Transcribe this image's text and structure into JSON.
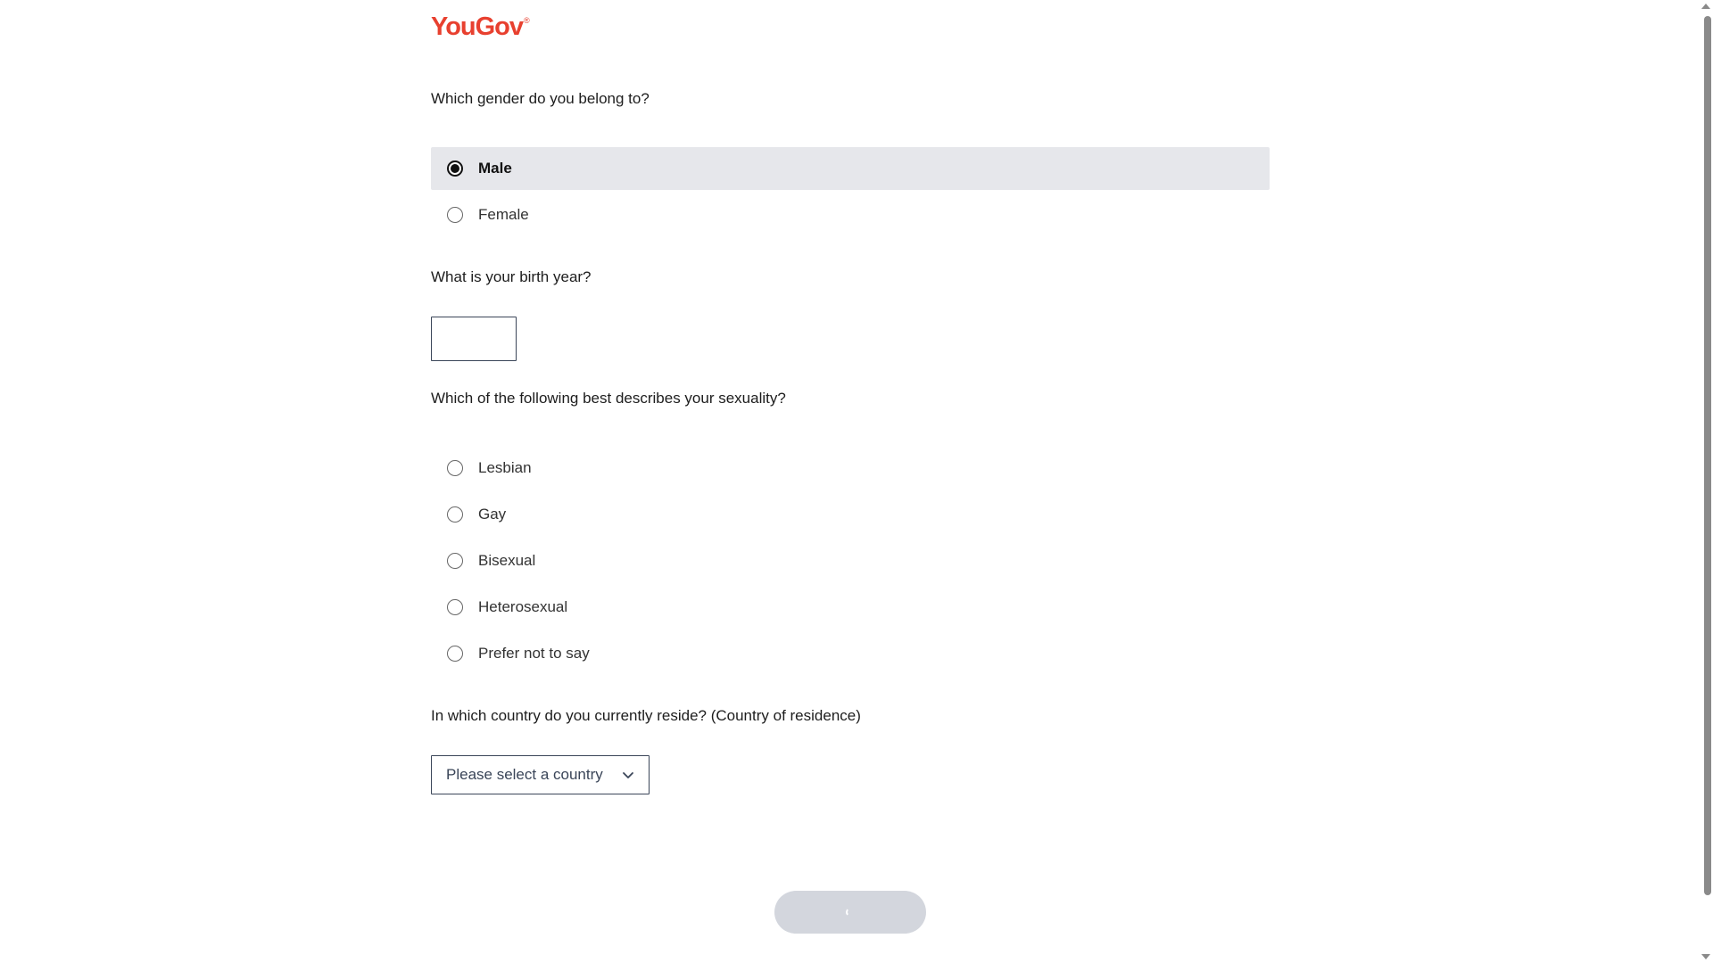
{
  "brand": {
    "logo_text": "YouGov",
    "logo_mark": "®",
    "color": "#e8402f"
  },
  "questions": {
    "gender": {
      "text": "Which gender do you belong to?",
      "options": [
        {
          "label": "Male",
          "selected": true
        },
        {
          "label": "Female",
          "selected": false
        }
      ]
    },
    "birth_year": {
      "text": "What is your birth year?",
      "value": "",
      "placeholder": ""
    },
    "sexuality": {
      "text": "Which of the following best describes your sexuality?",
      "options": [
        {
          "label": "Lesbian",
          "selected": false
        },
        {
          "label": "Gay",
          "selected": false
        },
        {
          "label": "Bisexual",
          "selected": false
        },
        {
          "label": "Heterosexual",
          "selected": false
        },
        {
          "label": "Prefer not to say",
          "selected": false
        }
      ]
    },
    "country": {
      "text": "In which country do you currently reside? (Country of residence)",
      "select_value": "Please select a country"
    }
  },
  "next_button": {
    "state": "loading",
    "icon": "spinner-icon"
  },
  "colors": {
    "selected_bg": "#e6e7eb",
    "button_bg": "#d3d6dd",
    "border": "#3a4558"
  }
}
